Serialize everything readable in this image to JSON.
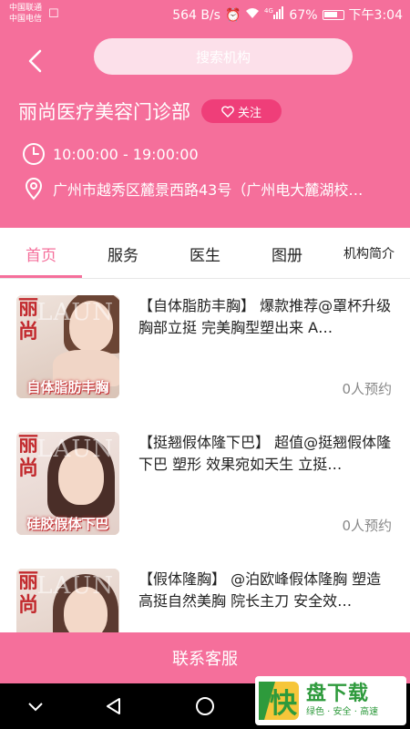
{
  "status_bar": {
    "carrier1": "中国联通",
    "carrier2": "中国电信",
    "speed": "564 B/s",
    "signal_tag": "4G",
    "battery": "67%",
    "time": "下午3:04"
  },
  "header": {
    "search_placeholder": "搜索机构",
    "org_name": "丽尚医疗美容门诊部",
    "follow_label": "关注",
    "hours": "10:00:00 - 19:00:00",
    "address": "广州市越秀区麓景西路43号（广州电大麓湖校…"
  },
  "tabs": [
    {
      "label": "首页"
    },
    {
      "label": "服务"
    },
    {
      "label": "医生"
    },
    {
      "label": "图册"
    },
    {
      "label": "机构简介"
    }
  ],
  "items": [
    {
      "title": "【自体脂肪丰胸】 爆款推荐@罩杯升级 胸部立挺 完美胸型塑出来 A…",
      "count": "0人预约",
      "thumb_caption": "自体脂肪丰胸"
    },
    {
      "title": "【挺翘假体隆下巴】 超值@挺翘假体隆下巴 塑形 效果宛如天生 立挺…",
      "count": "0人预约",
      "thumb_caption": "硅胶假体下巴"
    },
    {
      "title": "【假体隆胸】 @泊欧峰假体隆胸 塑造高挺自然美胸 院长主刀 安全效…",
      "count": "",
      "thumb_caption": ""
    }
  ],
  "thumb_brand": {
    "cn": "丽尚",
    "en": "LAUN"
  },
  "bottom": {
    "contact_label": "联系客服"
  },
  "watermark": {
    "main": "盘下载",
    "sub": "绿色 · 安全 · 高速",
    "logo_char": "快"
  },
  "colors": {
    "accent": "#f56f9b",
    "follow": "#ef3e79",
    "thumb_red": "#c22a2e"
  }
}
